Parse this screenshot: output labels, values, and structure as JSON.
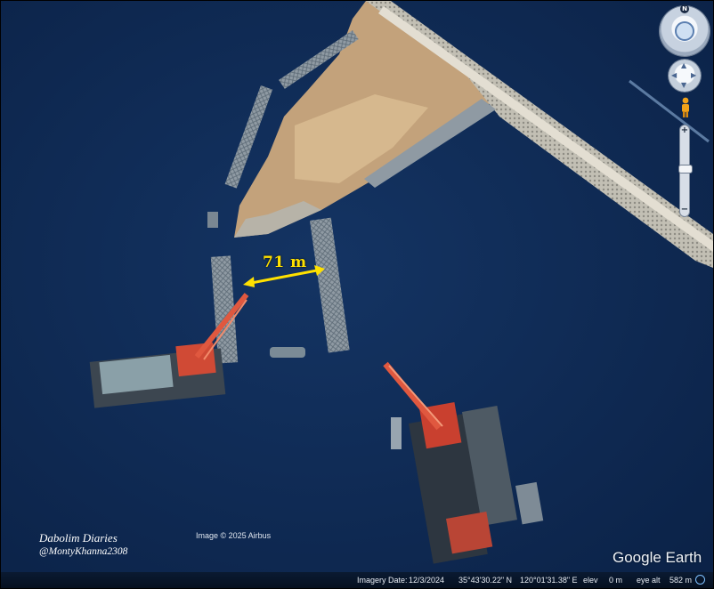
{
  "map": {
    "measurement_label": "71 m",
    "image_credit": "Image © 2025 Airbus",
    "logo_text": "Google Earth"
  },
  "watermark": {
    "title": "Dabolim Diaries",
    "handle": "@MontyKhanna2308"
  },
  "navigation": {
    "north_label": "N",
    "zoom_in_symbol": "+",
    "zoom_out_symbol": "−",
    "zoom_level": 0.45,
    "icons": [
      "look-around-icon",
      "move-joystick-icon",
      "street-view-pegman-icon"
    ]
  },
  "status_bar": {
    "imagery_date_label": "Imagery Date:",
    "imagery_date": "12/3/2024",
    "latitude": "35°43'30.22\" N",
    "longitude": "120°01'31.38\" E",
    "elev_label": "elev",
    "elev_value": "0 m",
    "eye_alt_label": "eye alt",
    "eye_alt_value": "582 m"
  },
  "colors": {
    "water": "#0f2a52",
    "sand": "#c9a77c",
    "breakwater": "#b9b6ac",
    "crane": "#d8452f",
    "measurement": "#ffe100"
  }
}
